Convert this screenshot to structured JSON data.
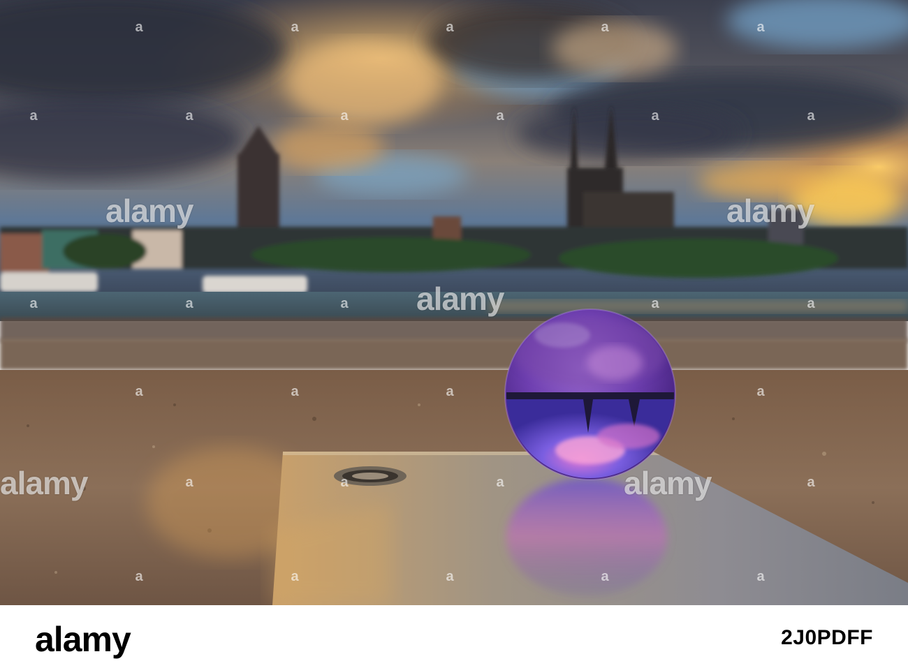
{
  "image": {
    "description_colors": {
      "sky_dark": "#2a3246",
      "sky_gold": "#e8a850",
      "sky_blue": "#5d8fb8",
      "ground": "#8a6d55",
      "plate": "#9d8f7c",
      "ball": "#6b3fae"
    }
  },
  "watermark": {
    "text": "alamy",
    "footer_logo": "alamy",
    "stock_id": "2J0PDFF",
    "dot": "a"
  }
}
